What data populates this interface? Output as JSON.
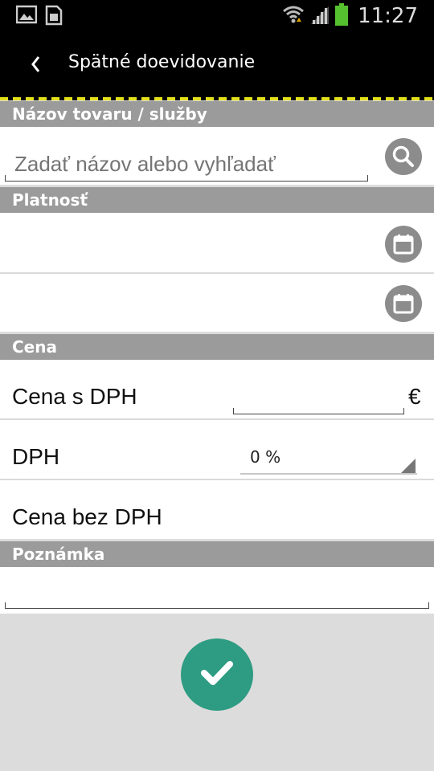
{
  "status_bar": {
    "time": "11:27",
    "icons": [
      "image-icon",
      "sim-card-icon",
      "wifi-icon",
      "signal-icon",
      "battery-icon"
    ]
  },
  "action_bar": {
    "back_icon": "chevron-left-icon",
    "title": "Spätné doevidovanie"
  },
  "sections": {
    "product": {
      "header": "Názov tovaru / služby",
      "input_placeholder": "Zadať názov alebo vyhľadať",
      "search_icon": "search-icon"
    },
    "validity": {
      "header": "Platnosť",
      "date_from_icon": "calendar-icon",
      "date_to_icon": "calendar-icon"
    },
    "price": {
      "header": "Cena",
      "price_with_vat_label": "Cena s DPH",
      "currency": "€",
      "vat_label": "DPH",
      "vat_value": "0 %",
      "price_without_vat_label": "Cena bez DPH"
    },
    "note": {
      "header": "Poznámka"
    }
  },
  "confirm_icon": "checkmark-icon",
  "colors": {
    "accent_green": "#2e9c82",
    "section_gray": "#9b9b9b",
    "hazard_yellow": "#e4e01a"
  }
}
